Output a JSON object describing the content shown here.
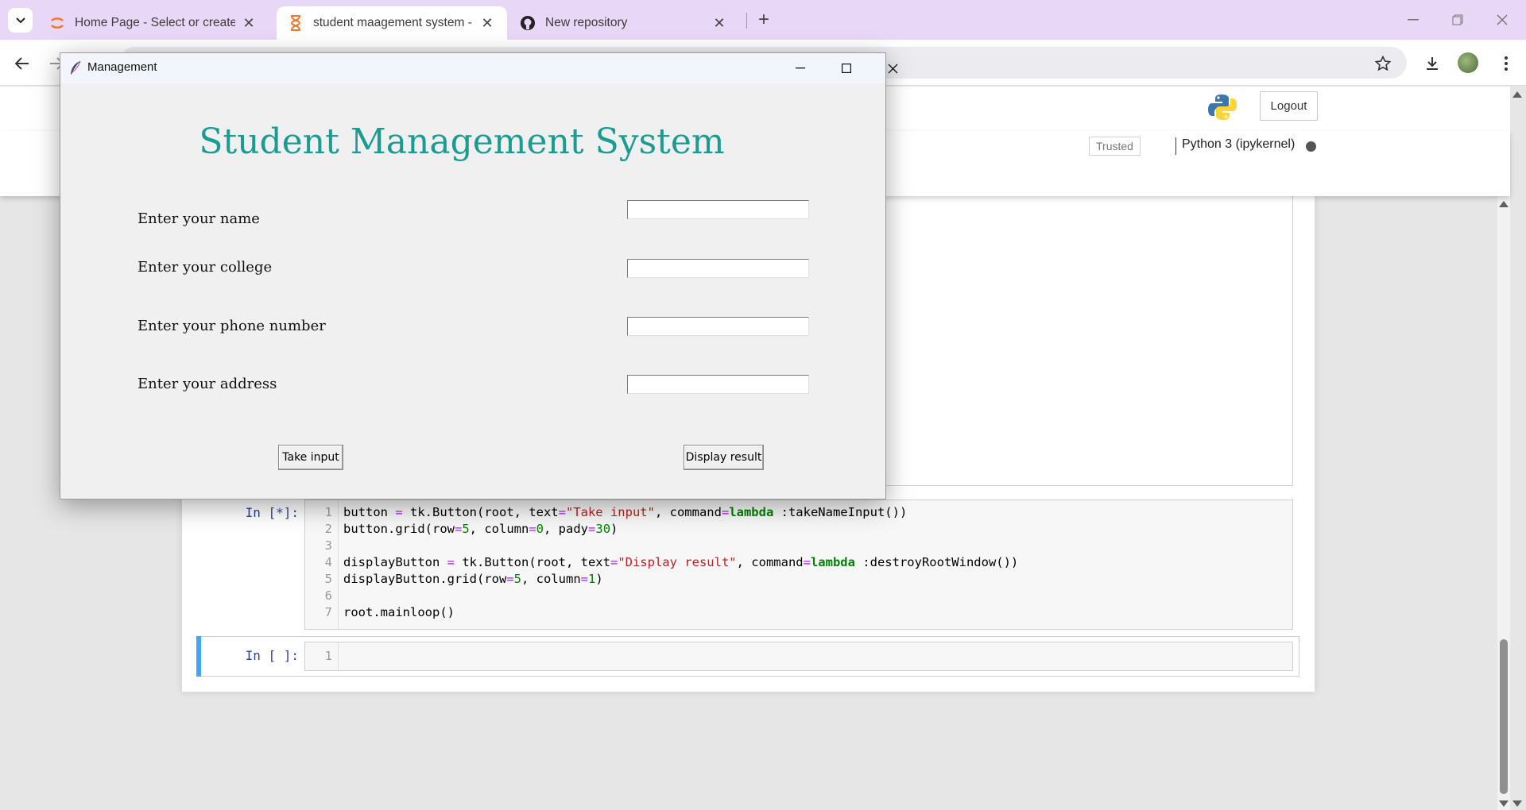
{
  "browser": {
    "tabs": [
      {
        "title": "Home Page - Select or create a",
        "icon": "jupyter-icon",
        "active": false
      },
      {
        "title": "student maagement system - Ju",
        "icon": "hourglass-icon",
        "active": true
      },
      {
        "title": "New repository",
        "icon": "github-icon",
        "active": false
      }
    ]
  },
  "jupyter": {
    "logout_label": "Logout",
    "trusted_label": "Trusted",
    "kernel_label": "Python 3 (ipykernel)",
    "cells": [
      {
        "prompt": "In [*]:",
        "line_numbers": [
          "1",
          "2",
          "3",
          "4",
          "5",
          "6",
          "7"
        ]
      },
      {
        "prompt": "In [ ]:",
        "line_numbers": [
          "1"
        ]
      }
    ]
  },
  "tk_window": {
    "title": "Management",
    "heading": "Student Management System",
    "fields": [
      {
        "label": "Enter your name",
        "value": ""
      },
      {
        "label": "Enter your college",
        "value": ""
      },
      {
        "label": "Enter your phone number",
        "value": ""
      },
      {
        "label": "Enter your address",
        "value": ""
      }
    ],
    "take_input_label": "Take input",
    "display_result_label": "Display result"
  },
  "colors": {
    "tabstrip": "#e8d7f6",
    "heading": "#1a9c93",
    "selected_cell_bar": "#42a5f5",
    "prompt": "#303f9f"
  }
}
